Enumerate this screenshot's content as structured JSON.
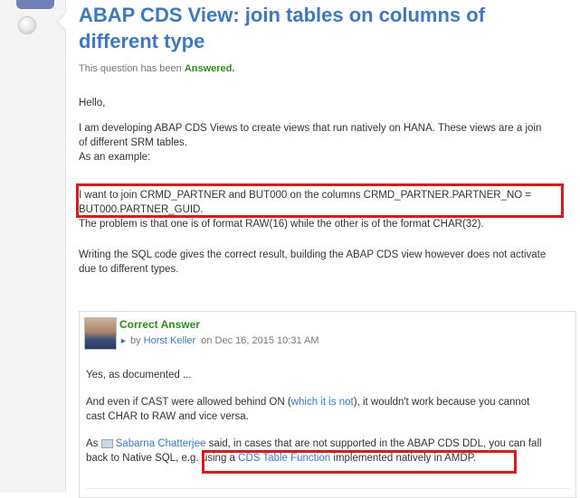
{
  "question": {
    "title": "ABAP CDS View: join tables on columns of different type",
    "status_prefix": "This question has been",
    "status_value": "Answered.",
    "paragraphs": {
      "greeting": "Hello,",
      "intro_line1": "I am developing ABAP CDS Views to create views that run natively on HANA. These views are a join",
      "intro_line2": "of different SRM tables.",
      "intro_line3": "As an example:",
      "join_line1": "I want to join CRMD_PARTNER and BUT000 on the columns CRMD_PARTNER.PARTNER_NO =",
      "join_line2": "BUT000.PARTNER_GUID.",
      "problem_line": "The problem is that one is of format RAW(16) while the other is of the format CHAR(32).",
      "sql_line1": "Writing the SQL code gives the correct result, building the ABAP CDS view however does not activate",
      "sql_line2": "due to different types."
    }
  },
  "answer": {
    "label": "Correct Answer",
    "by": "by",
    "author": "Horst Keller",
    "date": "on Dec 16, 2015 10:31 AM",
    "p1": "Yes, as documented ...",
    "p2_before": "And even if CAST were allowed behind ON (",
    "p2_link": "which it is not",
    "p2_after": "), it wouldn't work because you cannot",
    "p2_line2": "cast CHAR to RAW and vice versa.",
    "p3_as": "As",
    "p3_user": "Sabarna Chatterjee",
    "p3_after": "said, in cases that are not supported in the ABAP CDS DDL, you can fall",
    "p3_line2_before": "back to Native SQL, e.g. using a",
    "p3_link": "CDS Table Function",
    "p3_line2_after": "implemented natively in AMDP."
  },
  "colors": {
    "title_blue": "#3d78c1",
    "answered_green": "#2e8b1e",
    "highlight_red": "#d51d1d"
  }
}
